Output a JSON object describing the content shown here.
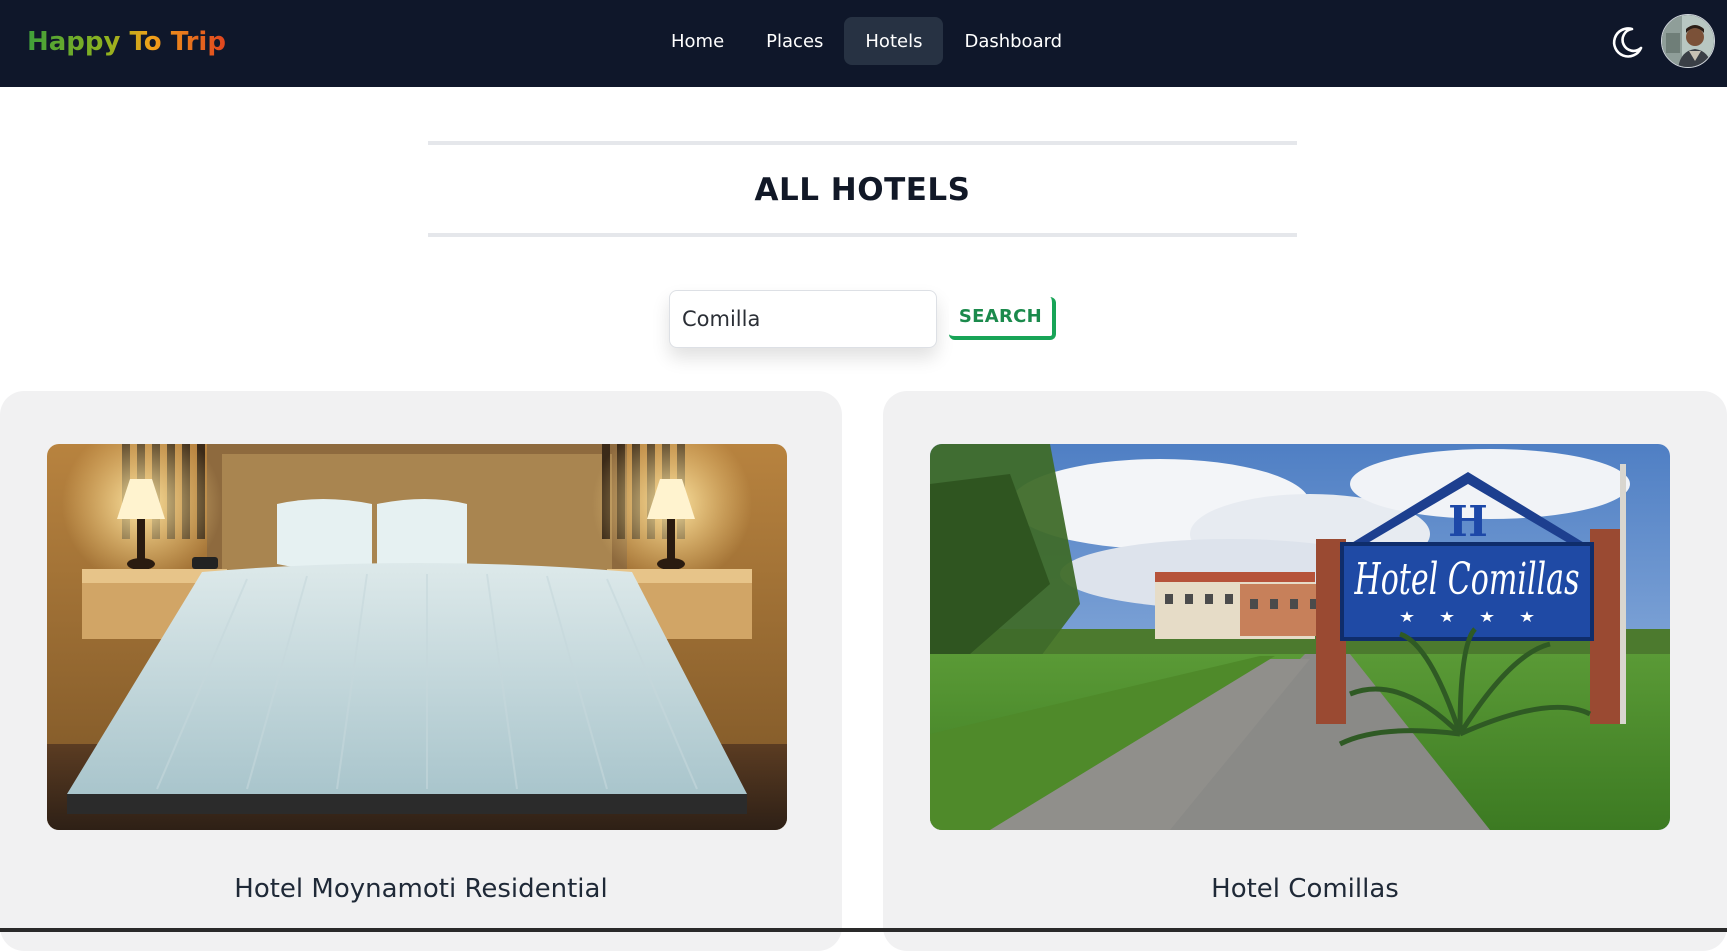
{
  "brand": "Happy To Trip",
  "nav": {
    "items": [
      {
        "label": "Home",
        "active": false
      },
      {
        "label": "Places",
        "active": false
      },
      {
        "label": "Hotels",
        "active": true
      },
      {
        "label": "Dashboard",
        "active": false
      }
    ]
  },
  "header": {
    "theme_icon": "moon-icon",
    "avatar_icon": "user-avatar"
  },
  "page": {
    "title": "ALL HOTELS"
  },
  "search": {
    "value": "Comilla",
    "button_label": "SEARCH"
  },
  "hotels": [
    {
      "name": "Hotel Moynamoti Residential",
      "image": "hotel-bedroom-image"
    },
    {
      "name": "Hotel Comillas",
      "image": "hotel-exterior-sign-image",
      "sign_text": "Hotel Comillas",
      "sign_letter": "H"
    }
  ],
  "colors": {
    "navbar": "#0f172a",
    "active_nav": "#273243",
    "accent_green": "#18a457",
    "card_bg": "#f1f1f2"
  }
}
